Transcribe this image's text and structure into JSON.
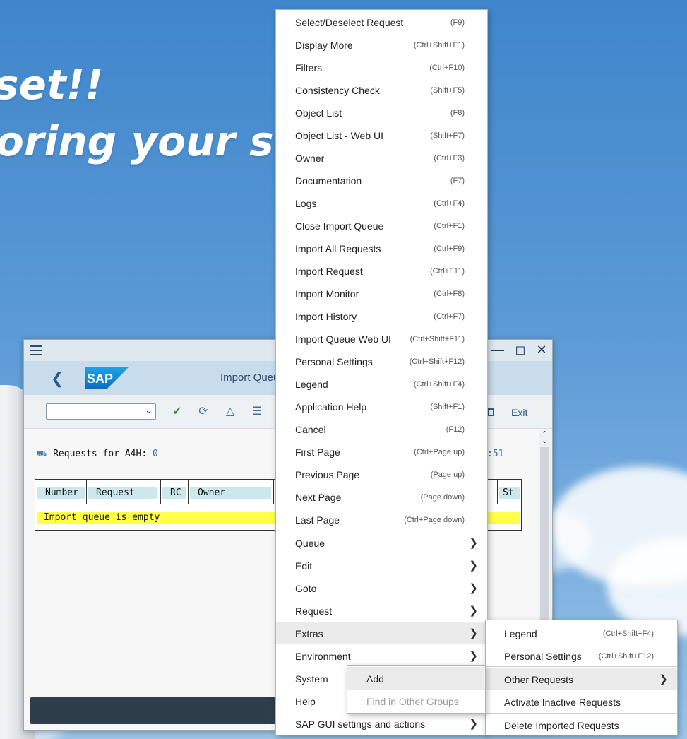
{
  "background": {
    "line1": "set!!",
    "line2": "oring your solu"
  },
  "sap_window": {
    "title": "Import Queu",
    "exit_label": "Exit",
    "requests_label": "Requests for A4H:",
    "requests_count": "0",
    "time_fragment": ":51",
    "table": {
      "columns": [
        "Number",
        "Request",
        "RC",
        "Owner",
        "St"
      ],
      "empty_message": "Import queue is empty"
    }
  },
  "context_menu": {
    "items": [
      {
        "label": "Select/Deselect Request",
        "shortcut": "(F9)"
      },
      {
        "label": "Display More",
        "shortcut": "(Ctrl+Shift+F1)"
      },
      {
        "label": "Filters",
        "shortcut": "(Ctrl+F10)"
      },
      {
        "label": "Consistency Check",
        "shortcut": "(Shift+F5)"
      },
      {
        "label": "Object List",
        "shortcut": "(F8)"
      },
      {
        "label": "Object List - Web UI",
        "shortcut": "(Shift+F7)"
      },
      {
        "label": "Owner",
        "shortcut": "(Ctrl+F3)"
      },
      {
        "label": "Documentation",
        "shortcut": "(F7)"
      },
      {
        "label": "Logs",
        "shortcut": "(Ctrl+F4)"
      },
      {
        "label": "Close Import Queue",
        "shortcut": "(Ctrl+F1)"
      },
      {
        "label": "Import All Requests",
        "shortcut": "(Ctrl+F9)"
      },
      {
        "label": "Import Request",
        "shortcut": "(Ctrl+F11)"
      },
      {
        "label": "Import Monitor",
        "shortcut": "(Ctrl+F8)"
      },
      {
        "label": "Import History",
        "shortcut": "(Ctrl+F7)"
      },
      {
        "label": "Import Queue Web UI",
        "shortcut": "(Ctrl+Shift+F11)"
      },
      {
        "label": "Personal Settings",
        "shortcut": "(Ctrl+Shift+F12)"
      },
      {
        "label": "Legend",
        "shortcut": "(Ctrl+Shift+F4)"
      },
      {
        "label": "Application Help",
        "shortcut": "(Shift+F1)"
      },
      {
        "label": "Cancel",
        "shortcut": "(F12)"
      },
      {
        "label": "First Page",
        "shortcut": "(Ctrl+Page up)"
      },
      {
        "label": "Previous Page",
        "shortcut": "(Page up)"
      },
      {
        "label": "Next Page",
        "shortcut": "(Page down)"
      },
      {
        "label": "Last Page",
        "shortcut": "(Ctrl+Page down)"
      }
    ],
    "submenus": [
      {
        "label": "Queue"
      },
      {
        "label": "Edit"
      },
      {
        "label": "Goto"
      },
      {
        "label": "Request"
      },
      {
        "label": "Extras"
      },
      {
        "label": "Environment"
      },
      {
        "label": "System"
      },
      {
        "label": "Help"
      },
      {
        "label": "SAP GUI settings and actions"
      }
    ]
  },
  "extras_menu": {
    "items": [
      {
        "label": "Legend",
        "shortcut": "(Ctrl+Shift+F4)"
      },
      {
        "label": "Personal Settings",
        "shortcut": "(Ctrl+Shift+F12)"
      },
      {
        "label": "Other Requests",
        "shortcut": ""
      },
      {
        "label": "Activate Inactive Requests",
        "shortcut": ""
      },
      {
        "label": "Delete Imported Requests",
        "shortcut": ""
      }
    ]
  },
  "other_requests_menu": {
    "items": [
      {
        "label": "Add"
      },
      {
        "label": "Find in Other Groups"
      }
    ]
  }
}
